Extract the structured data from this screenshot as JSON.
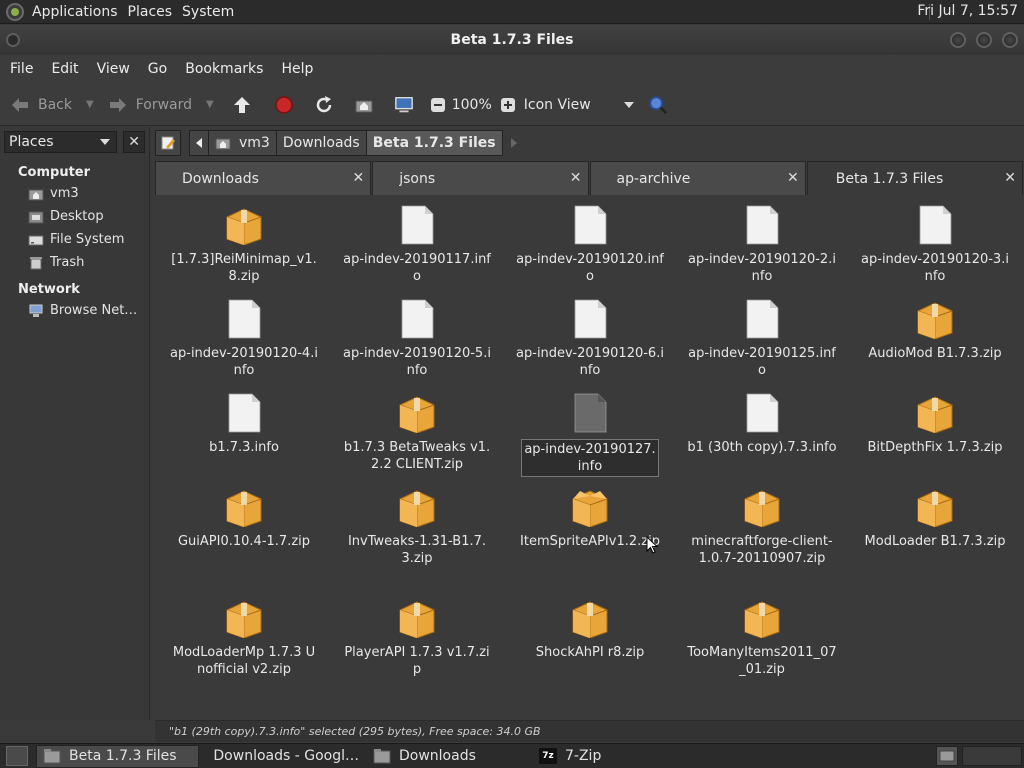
{
  "top_panel": {
    "menus": [
      "Applications",
      "Places",
      "System"
    ],
    "clock": "Fri Jul  7, 15:57"
  },
  "window": {
    "title": "Beta 1.7.3 Files"
  },
  "menubar": [
    "File",
    "Edit",
    "View",
    "Go",
    "Bookmarks",
    "Help"
  ],
  "toolbar": {
    "back": "Back",
    "forward": "Forward",
    "zoom": "100%",
    "view_mode": "Icon View"
  },
  "sidebar": {
    "selector": "Places",
    "sections": [
      {
        "title": "Computer",
        "items": [
          {
            "label": "vm3",
            "icon": "home-icon"
          },
          {
            "label": "Desktop",
            "icon": "desktop-folder-icon"
          },
          {
            "label": "File System",
            "icon": "drive-icon"
          },
          {
            "label": "Trash",
            "icon": "trash-icon"
          }
        ]
      },
      {
        "title": "Network",
        "items": [
          {
            "label": "Browse Net…",
            "icon": "network-icon"
          }
        ]
      }
    ]
  },
  "breadcrumb": [
    "vm3",
    "Downloads",
    "Beta 1.7.3 Files"
  ],
  "tabs": [
    "Downloads",
    "jsons",
    "ap-archive",
    "Beta 1.7.3 Files"
  ],
  "files": [
    {
      "name": "[1.7.3]ReiMinimap_v1.8.zip",
      "type": "zip"
    },
    {
      "name": "ap-indev-20190117.info",
      "type": "doc"
    },
    {
      "name": "ap-indev-20190120.info",
      "type": "doc"
    },
    {
      "name": "ap-indev-20190120-2.info",
      "type": "doc"
    },
    {
      "name": "ap-indev-20190120-3.info",
      "type": "doc"
    },
    {
      "name": "ap-indev-20190120-4.info",
      "type": "doc"
    },
    {
      "name": "ap-indev-20190120-5.info",
      "type": "doc"
    },
    {
      "name": "ap-indev-20190120-6.info",
      "type": "doc"
    },
    {
      "name": "ap-indev-20190125.info",
      "type": "doc"
    },
    {
      "name": "AudioMod B1.7.3.zip",
      "type": "zip"
    },
    {
      "name": "b1.7.3.info",
      "type": "doc"
    },
    {
      "name": "b1.7.3 BetaTweaks v1.2.2 CLIENT.zip",
      "type": "zip"
    },
    {
      "name": "ap-indev-20190127.info",
      "type": "doc-grey",
      "renaming": true
    },
    {
      "name": "b1 (30th copy).7.3.info",
      "type": "doc"
    },
    {
      "name": "BitDepthFix 1.7.3.zip",
      "type": "zip"
    },
    {
      "name": "GuiAPI0.10.4-1.7.zip",
      "type": "zip"
    },
    {
      "name": "InvTweaks-1.31-B1.7.3.zip",
      "type": "zip"
    },
    {
      "name": "ItemSpriteAPIv1.2.zip",
      "type": "zip-open"
    },
    {
      "name": "minecraftforge-client-1.0.7-20110907.zip",
      "type": "zip"
    },
    {
      "name": "ModLoader B1.7.3.zip",
      "type": "zip"
    },
    {
      "name": "ModLoaderMp 1.7.3 Unofficial v2.zip",
      "type": "zip"
    },
    {
      "name": "PlayerAPI 1.7.3 v1.7.zip",
      "type": "zip"
    },
    {
      "name": "ShockAhPI r8.zip",
      "type": "zip"
    },
    {
      "name": "TooManyItems2011_07_01.zip",
      "type": "zip"
    }
  ],
  "status": "\"b1 (29th copy).7.3.info\" selected (295 bytes), Free space: 34.0 GB",
  "taskbar": [
    {
      "label": "Beta 1.7.3 Files",
      "icon": "folder-icon",
      "active": true
    },
    {
      "label": "Downloads - Googl…",
      "icon": "chrome-icon",
      "active": false
    },
    {
      "label": "Downloads",
      "icon": "folder-icon",
      "active": false
    },
    {
      "label": "7-Zip",
      "icon": "7zip-icon",
      "active": false
    }
  ],
  "colors": {
    "folder": "#e8a53a",
    "doc": "#f2f2f2",
    "active_crumb": "#595959"
  }
}
